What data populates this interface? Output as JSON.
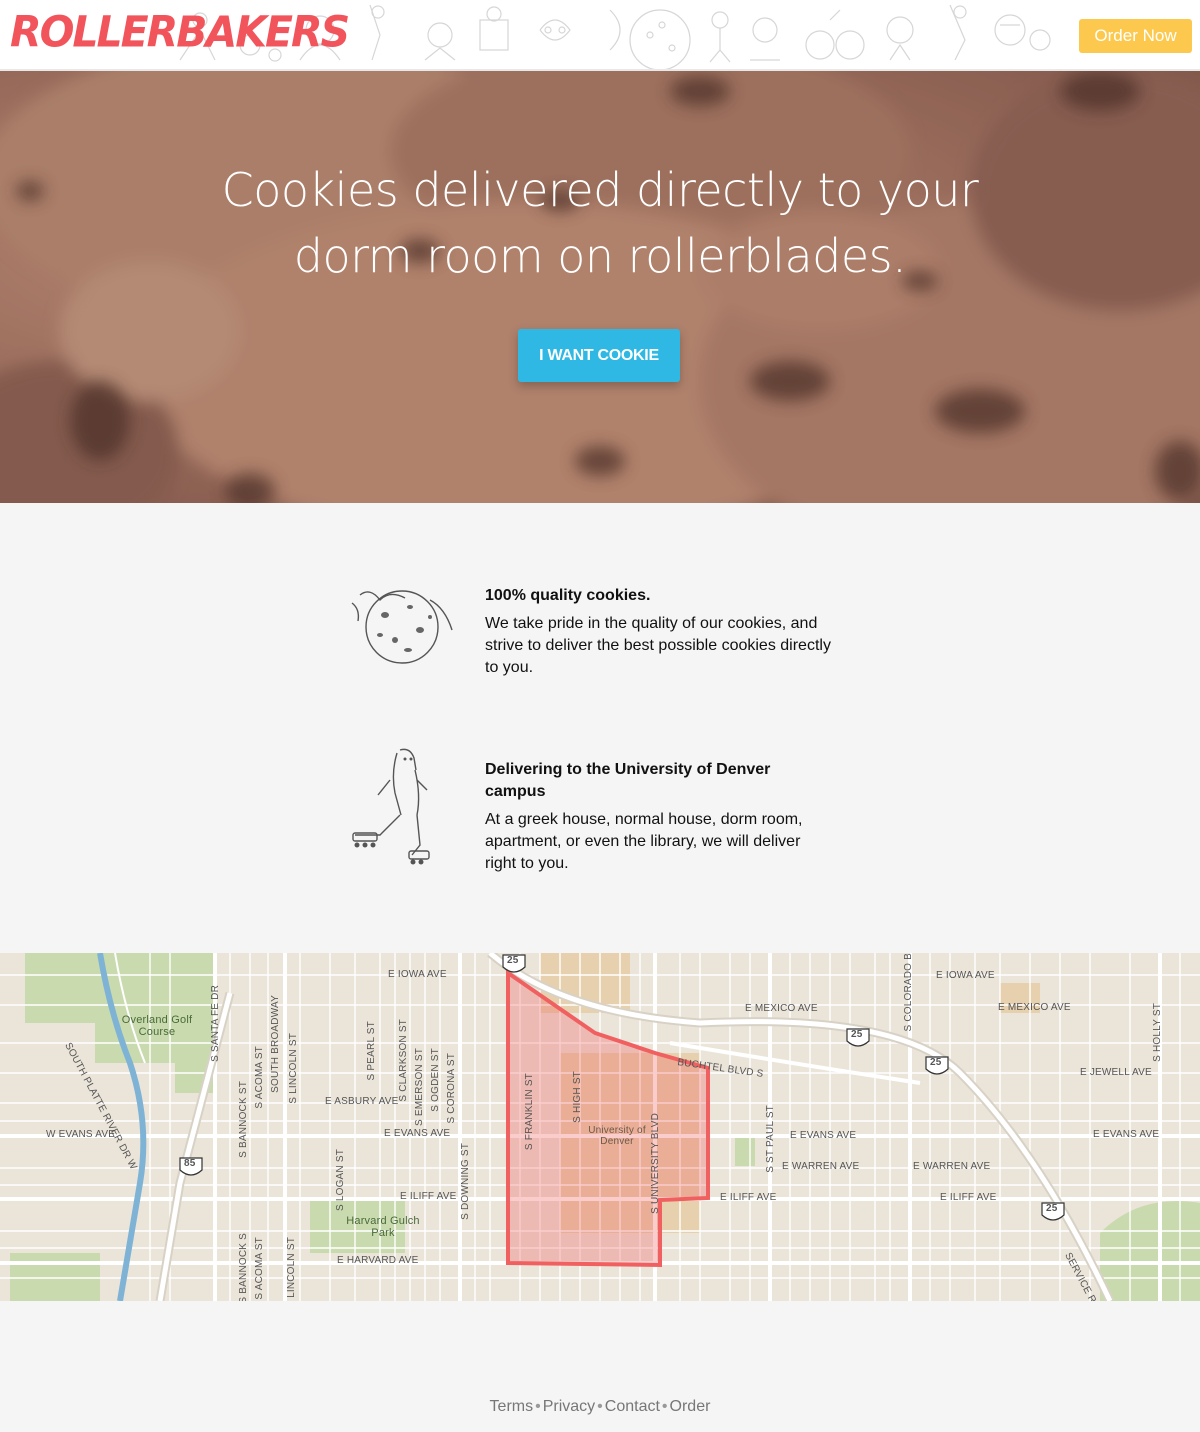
{
  "header": {
    "logo": "ROLLERBAKERS",
    "order_button": "Order Now"
  },
  "hero": {
    "title_line1": "Cookies delivered directly to your",
    "title_line2": "dorm room on rollerblades.",
    "cta": "I WANT COOKIE"
  },
  "features": [
    {
      "title": "100% quality cookies.",
      "description": "We take pride in the quality of our cookies, and strive to deliver the best possible cookies directly to you."
    },
    {
      "title": "Delivering to the University of Denver campus",
      "description": "At a greek house, normal house, dorm room, apartment, or even the library, we will deliver right to you."
    }
  ],
  "map": {
    "streets": {
      "iowa_w": "E IOWA AVE",
      "iowa_e": "E IOWA AVE",
      "mexico_1": "E MEXICO AVE",
      "mexico_2": "E MEXICO AVE",
      "jewell": "E JEWELL AVE",
      "asbury": "E ASBURY AVE",
      "evans_w": "W EVANS AVE",
      "evans_1": "E EVANS AVE",
      "evans_2": "E EVANS AVE",
      "evans_3": "E EVANS AVE",
      "warren_1": "E WARREN AVE",
      "warren_2": "E WARREN AVE",
      "iliff_1": "E ILIFF AVE",
      "iliff_2": "E ILIFF AVE",
      "iliff_3": "E ILIFF AVE",
      "harvard": "E HARVARD AVE",
      "buchtel": "BUCHTEL BLVD S",
      "santa_fe": "S SANTA FE DR",
      "platte": "SOUTH PLATTE RIVER DR W",
      "south_broadway": "SOUTH BROADWAY",
      "lincoln": "S LINCOLN ST",
      "acoma": "S ACOMA ST",
      "bannock": "S BANNOCK ST",
      "pearl": "S PEARL ST",
      "clarkson": "S CLARKSON ST",
      "emerson": "S EMERSON ST",
      "ogden": "S OGDEN ST",
      "corona": "S CORONA ST",
      "logan": "S LOGAN ST",
      "downing": "S DOWNING ST",
      "franklin": "S FRANKLIN ST",
      "high": "S HIGH ST",
      "university": "S UNIVERSITY BLVD",
      "st_paul": "S ST PAUL ST",
      "colorado": "S COLORADO B",
      "holly": "S HOLLY ST",
      "service": "SERVICE R",
      "bannock_2": "S BANNOCK S",
      "acoma_2": "S ACOMA ST",
      "lincoln_2": "S LINCOLN ST"
    },
    "places": {
      "overland_1": "Overland Golf",
      "overland_2": "Course",
      "harvard_gulch_1": "Harvard Gulch",
      "harvard_gulch_2": "Park",
      "du_1": "University of",
      "du_2": "Denver"
    },
    "shields": {
      "i25_a": "25",
      "i25_b": "25",
      "i25_c": "25",
      "i25_d": "25",
      "us85": "85"
    }
  },
  "footer": {
    "links": [
      "Terms",
      "Privacy",
      "Contact",
      "Order"
    ]
  },
  "colors": {
    "brand_red": "#f2545b",
    "order_yellow": "#fcc94e",
    "cta_blue": "#2fb8e4"
  }
}
